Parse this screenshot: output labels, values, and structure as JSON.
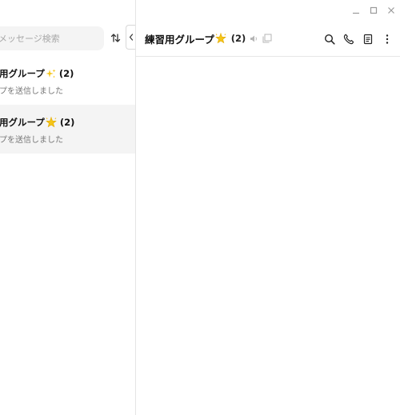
{
  "search": {
    "placeholder": "メッセージ検索"
  },
  "chats": [
    {
      "name": "用グループ",
      "emoji": "sparkles",
      "count": "(2)",
      "preview": "プを送信しました"
    },
    {
      "name": "用グループ",
      "emoji": "star",
      "count": "(2)",
      "preview": "プを送信しました"
    }
  ],
  "header": {
    "title": "練習用グループ",
    "title_emoji": "star",
    "member_count": "(2)"
  },
  "colors": {
    "selected_row": "#f4f4f4",
    "border": "#e4e4e4",
    "icon": "#333333",
    "muted_icon": "#b5b5b5",
    "star": "#f5c518"
  }
}
